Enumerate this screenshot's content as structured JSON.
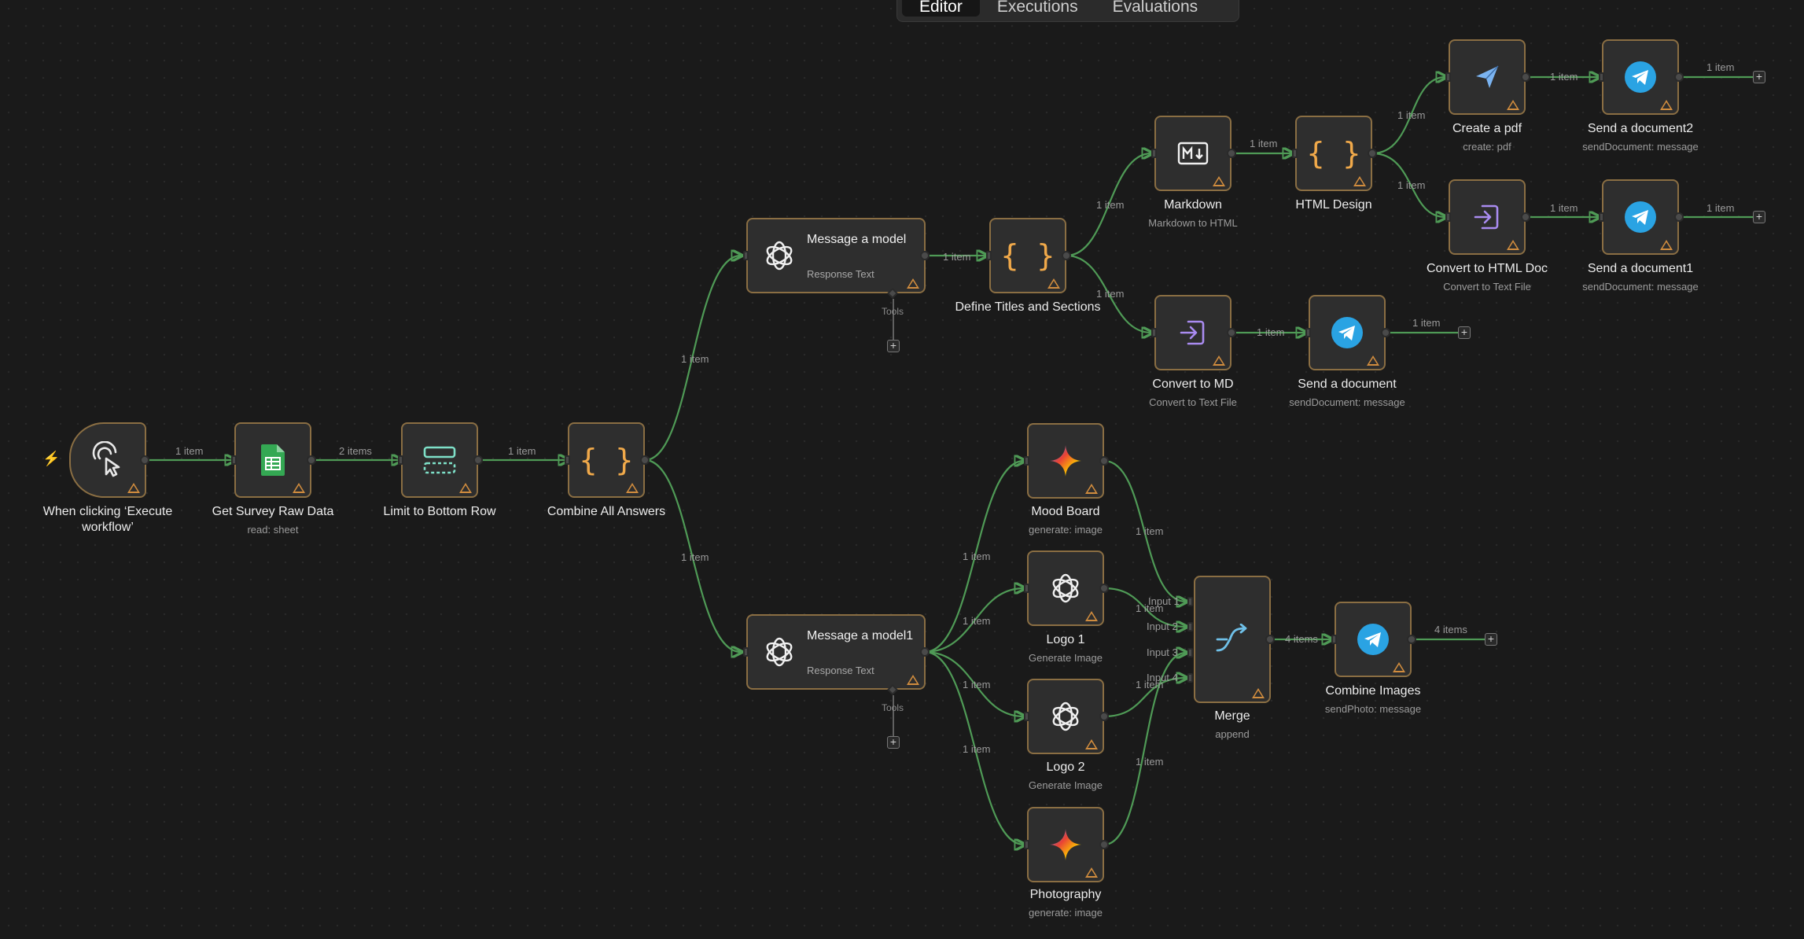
{
  "tabs": [
    {
      "label": "Editor",
      "active": true
    },
    {
      "label": "Executions",
      "active": false
    },
    {
      "label": "Evaluations",
      "active": false
    }
  ],
  "nodes": {
    "trigger": {
      "title": "When clicking ‘Execute workflow’",
      "icon": "cursor-click-icon"
    },
    "sheet": {
      "title": "Get Survey Raw Data",
      "subtitle": "read: sheet",
      "icon": "google-sheets-icon"
    },
    "limit": {
      "title": "Limit to Bottom Row",
      "icon": "limit-icon"
    },
    "combine": {
      "title": "Combine All Answers",
      "icon": "code-braces-icon"
    },
    "model": {
      "title": "Message a model",
      "subtitle": "Response Text",
      "icon": "openai-icon"
    },
    "model1": {
      "title": "Message a model1",
      "subtitle": "Response Text",
      "icon": "openai-icon"
    },
    "define": {
      "title": "Define Titles and Sections",
      "icon": "code-braces-icon"
    },
    "markdown": {
      "title": "Markdown",
      "subtitle": "Markdown to HTML",
      "icon": "markdown-icon"
    },
    "html": {
      "title": "HTML Design",
      "icon": "code-braces-icon"
    },
    "pdf": {
      "title": "Create a pdf",
      "subtitle": "create: pdf",
      "icon": "paper-plane-icon"
    },
    "send2": {
      "title": "Send a document2",
      "subtitle": "sendDocument: message",
      "icon": "telegram-icon"
    },
    "convhtml": {
      "title": "Convert to HTML Doc",
      "subtitle": "Convert to Text File",
      "icon": "file-convert-icon"
    },
    "send1": {
      "title": "Send a document1",
      "subtitle": "sendDocument: message",
      "icon": "telegram-icon"
    },
    "convmd": {
      "title": "Convert to MD",
      "subtitle": "Convert to Text File",
      "icon": "file-convert-icon"
    },
    "send": {
      "title": "Send a document",
      "subtitle": "sendDocument: message",
      "icon": "telegram-icon"
    },
    "mood": {
      "title": "Mood Board",
      "subtitle": "generate: image",
      "icon": "gemini-sparkle-icon"
    },
    "logo1": {
      "title": "Logo 1",
      "subtitle": "Generate Image",
      "icon": "openai-icon"
    },
    "logo2": {
      "title": "Logo 2",
      "subtitle": "Generate Image",
      "icon": "openai-icon"
    },
    "photo": {
      "title": "Photography",
      "subtitle": "generate: image",
      "icon": "gemini-sparkle-icon"
    },
    "merge": {
      "title": "Merge",
      "subtitle": "append",
      "icon": "merge-icon"
    },
    "images": {
      "title": "Combine Images",
      "subtitle": "sendPhoto: message",
      "icon": "telegram-icon"
    }
  },
  "edge_labels": {
    "trigger_sheet": "1 item",
    "sheet_limit": "2 items",
    "limit_combine": "1 item",
    "combine_model": "1 item",
    "combine_model1": "1 item",
    "model_define": "1 item",
    "define_markdown": "1 item",
    "define_convmd": "1 item",
    "markdown_html": "1 item",
    "html_pdf": "1 item",
    "html_convhtml": "1 item",
    "pdf_send2": "1 item",
    "convhtml_send1": "1 item",
    "convmd_send": "1 item",
    "send2_out": "1 item",
    "send1_out": "1 item",
    "send_out": "1 item",
    "model1_mood": "1 item",
    "model1_logo1": "1 item",
    "model1_logo2": "1 item",
    "model1_photo": "1 item",
    "mood_merge": "1 item",
    "logo1_merge": "1 item",
    "logo2_merge": "1 item",
    "photo_merge": "1 item",
    "merge_images": "4 items",
    "images_out": "4 items"
  },
  "merge_inputs": [
    "Input 1",
    "Input 2",
    "Input 3",
    "Input 4"
  ],
  "tools_label": "Tools",
  "colors": {
    "background": "#1a1a1a",
    "node_fill": "#2e2e2e",
    "node_border": "#8a6e43",
    "edge": "#4f9a56",
    "warning": "#d08c3e",
    "telegram": "#2aa3e3",
    "sheets": "#34a853",
    "trigger_bolt": "#e8743b"
  }
}
